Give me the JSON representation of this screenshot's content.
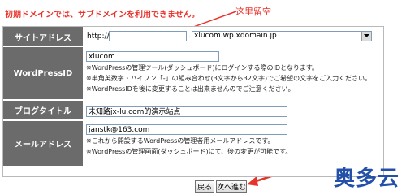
{
  "notice": "初期ドメインでは、サブドメインを利用できません。",
  "annotation": "这里留空",
  "rows": {
    "site_address": {
      "label": "サイトアドレス",
      "prefix": "http://",
      "subdomain_value": "",
      "domain_select": "xlucom.wp.xdomain.jp"
    },
    "wordpress_id": {
      "label": "WordPressID",
      "value": "xlucom",
      "notes": [
        "※WordPressの管理ツール(ダッシュボード)にログインする際のIDとなります。",
        "※半角英数字・ハイフン「-」の組み合わせ(3文字から32文字)でご希望の文字をご入力ください。",
        "※WordPressIDを後に変更することは出来ませんのでご注意ください。"
      ]
    },
    "blog_title": {
      "label": "ブログタイトル",
      "value": "未知路jx-lu.com的演示站点"
    },
    "email": {
      "label": "メールアドレス",
      "value": "janstk@163.com",
      "notes": [
        "※これから開設するWordPressの管理者用メールアドレスです。",
        "※WordPressの管理画面(ダッシュボード)にて、後の変更が可能です。"
      ]
    }
  },
  "buttons": {
    "back": "戻る",
    "next": "次へ進む"
  },
  "brand": "奥多云",
  "colors": {
    "annotation": "#e8322a",
    "label_background": "#6b6b6b",
    "brand": "#2350a8"
  }
}
